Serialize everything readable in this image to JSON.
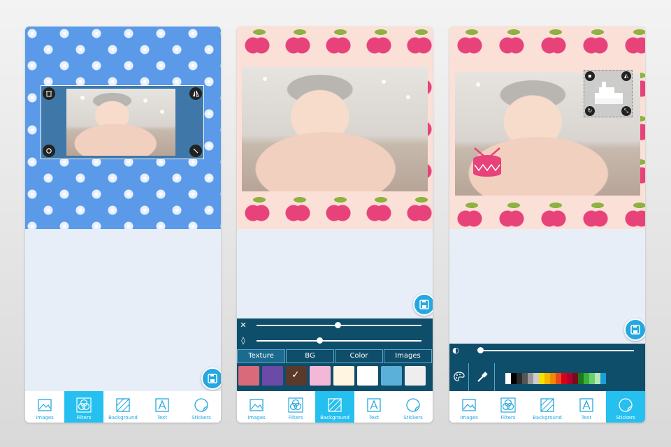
{
  "nav_items": [
    {
      "label": "Images",
      "icon": "image-icon"
    },
    {
      "label": "Filters",
      "icon": "filters-icon"
    },
    {
      "label": "Background",
      "icon": "background-icon"
    },
    {
      "label": "Text",
      "icon": "text-icon"
    },
    {
      "label": "Stickers",
      "icon": "stickers-icon"
    }
  ],
  "screens": [
    {
      "active_nav": "Filters",
      "pattern": "blue-flower"
    },
    {
      "active_nav": "Background",
      "pattern": "pink-apple"
    },
    {
      "active_nav": "Stickers",
      "pattern": "pink-apple"
    }
  ],
  "background_tabs": [
    "Texture",
    "BG",
    "Color",
    "Images"
  ],
  "active_background_tab": "Texture",
  "sliders": [
    {
      "icon": "close-icon",
      "level": 0.49
    },
    {
      "icon": "drop-icon",
      "level": 0.36
    }
  ],
  "sticker_slider": {
    "icon": "opacity-icon",
    "level": 0.02
  },
  "sticker_tools": [
    "palette-icon",
    "eyedropper-icon"
  ],
  "colors": {
    "accent": "#25a7e0",
    "active_nav": "#25c0f0",
    "panel": "#0e4e6b",
    "blue_bg": "#5b9ae8",
    "apple": "#e8427a",
    "apple_bg": "#fbe0d8",
    "drum": "#e8427a"
  },
  "swatches": [
    "#ffffff",
    "#000000",
    "#2b2b2b",
    "#555555",
    "#999999",
    "#cccccc",
    "#f5e000",
    "#f7b500",
    "#f08a00",
    "#e84a1a",
    "#d8001a",
    "#b0002f",
    "#7a0a1a",
    "#1a7a1a",
    "#3bb03b",
    "#6cd06c",
    "#b5e8b5",
    "#1a9fd6"
  ]
}
